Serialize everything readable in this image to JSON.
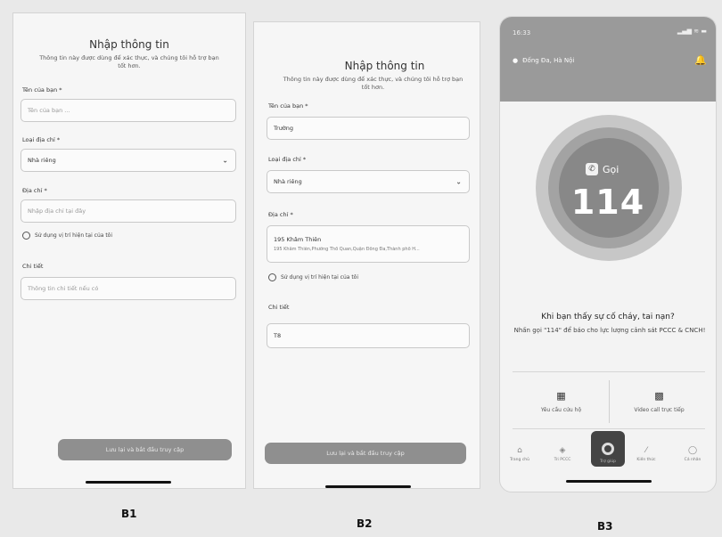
{
  "screens": [
    {
      "caption": "B1",
      "title": "Nhập thông tin",
      "description": "Thông tin này được dùng để xác thực, và chúng tôi hỗ trợ bạn tốt hơn.",
      "name_label": "Tên của bạn *",
      "name_value": "Tên của bạn ...",
      "address_type_label": "Loại địa chỉ *",
      "address_type_value": "Nhà riêng",
      "address_label": "Địa chỉ *",
      "address_value": "Nhập địa chỉ tại đây",
      "use_location_label": "Sử dụng vị trí hiện tại của tôi",
      "detail_label": "Chi tiết",
      "detail_value": "Thông tin chi tiết nếu có",
      "submit_label": "Lưu lại và bắt đầu truy cập"
    },
    {
      "caption": "B2",
      "title": "Nhập thông tin",
      "description": "Thông tin này được dùng để xác thực, và chúng tôi hỗ trợ bạn tốt hơn.",
      "name_label": "Tên của bạn *",
      "name_value": "Trường",
      "address_type_label": "Loại địa chỉ *",
      "address_type_value": "Nhà riêng",
      "address_label": "Địa chỉ *",
      "address_value": "195 Khâm Thiên",
      "address_sub": "195 Khâm Thiên,Phường Thổ Quan,Quận Đống Đa,Thành phố H...",
      "use_location_label": "Sử dụng vị trí hiện tại của tôi",
      "detail_label": "Chi tiết",
      "detail_value": "T8",
      "submit_label": "Lưu lại và bắt đầu truy cập"
    },
    {
      "caption": "B3",
      "status_time": "16:33",
      "status_icons": "▂▄▆ ≋ ▬",
      "location": "Đống Đa, Hà Nội",
      "call_label": "Gọi",
      "call_number": "114",
      "question": "Khi bạn thấy sự cố cháy, tai nạn?",
      "instruction": "Nhấn gọi \"114\" để báo cho lực lượng cảnh sát PCCC & CNCH!",
      "actions": [
        {
          "label": "Yêu cầu cứu hộ",
          "icon": "rescue-icon"
        },
        {
          "label": "Video call trực tiếp",
          "icon": "video-icon"
        }
      ],
      "tabs": [
        {
          "label": "Trang chủ",
          "icon": "home-icon"
        },
        {
          "label": "Tri PCCC",
          "icon": "shield-icon"
        },
        {
          "label": "Trợ giúp",
          "icon": "sos-icon"
        },
        {
          "label": "Kiến thức",
          "icon": "book-icon"
        },
        {
          "label": "Cá nhân",
          "icon": "user-icon"
        }
      ]
    }
  ]
}
